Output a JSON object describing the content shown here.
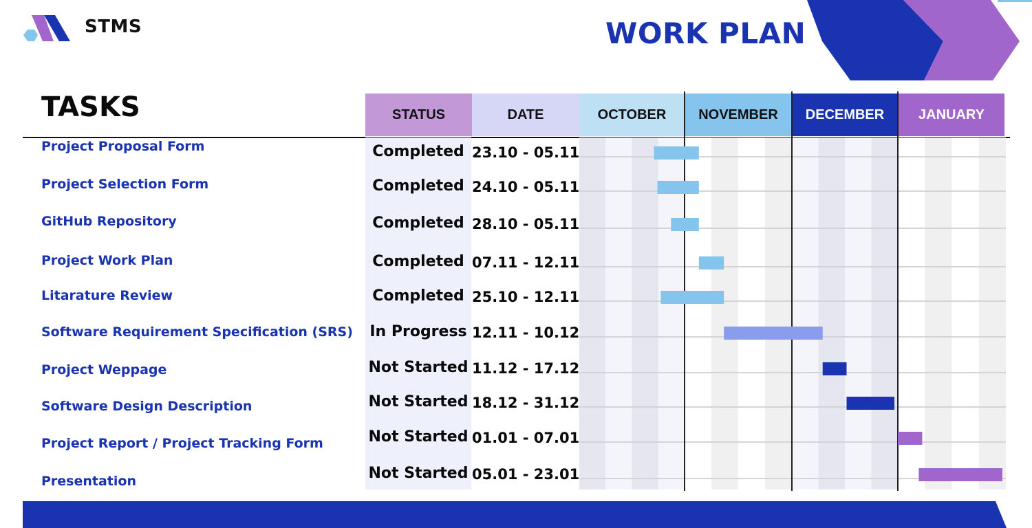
{
  "brand": {
    "name": "STMS"
  },
  "page_title": "WORK PLAN",
  "tasks_title": "TASKS",
  "colors": {
    "brand_blue": "#1a33b0",
    "purple": "#a066cc",
    "light_blue": "#85c4ec",
    "periwinkle": "#8a9cec"
  },
  "columns": [
    {
      "label": "STATUS",
      "bg": "#c298d6",
      "fg": "#111111"
    },
    {
      "label": "DATE",
      "bg": "#d6d6f7",
      "fg": "#111111"
    },
    {
      "label": "OCTOBER",
      "bg": "#bde0f4",
      "fg": "#111111"
    },
    {
      "label": "NOVEMBER",
      "bg": "#85c4ec",
      "fg": "#111111"
    },
    {
      "label": "DECEMBER",
      "bg": "#1a33b0",
      "fg": "#ffffff"
    },
    {
      "label": "JANUARY",
      "bg": "#a066cc",
      "fg": "#ffffff"
    }
  ],
  "chart_data": {
    "type": "gantt",
    "timeline_months": [
      "OCTOBER",
      "NOVEMBER",
      "DECEMBER",
      "JANUARY"
    ],
    "tasks": [
      {
        "name": "Project Proposal Form",
        "status": "Completed",
        "date": "23.10 - 05.11",
        "start": "10-23",
        "end": "11-05",
        "color": "#85c4ec"
      },
      {
        "name": "Project Selection Form",
        "status": "Completed",
        "date": "24.10 - 05.11",
        "start": "10-24",
        "end": "11-05",
        "color": "#85c4ec"
      },
      {
        "name": "GitHub Repository",
        "status": "Completed",
        "date": "28.10 - 05.11",
        "start": "10-28",
        "end": "11-05",
        "color": "#85c4ec"
      },
      {
        "name": "Project Work Plan",
        "status": "Completed",
        "date": "07.11 - 12.11",
        "start": "11-05",
        "end": "11-12",
        "color": "#85c4ec"
      },
      {
        "name": "Litarature Review",
        "status": "Completed",
        "date": "25.10 - 12.11",
        "start": "10-25",
        "end": "11-12",
        "color": "#85c4ec"
      },
      {
        "name": "Software Requirement Specification (SRS)",
        "status": "In Progress",
        "date": "12.11 - 10.12",
        "start": "11-12",
        "end": "12-10",
        "color": "#8a9cec"
      },
      {
        "name": "Project Weppage",
        "status": "Not Started",
        "date": "11.12 - 17.12",
        "start": "12-10",
        "end": "12-17",
        "color": "#1a33b0"
      },
      {
        "name": "Software Design Description",
        "status": "Not Started",
        "date": "18.12 - 31.12",
        "start": "12-17",
        "end": "12-31",
        "color": "#1a33b0"
      },
      {
        "name": "Project Report / Project Tracking Form",
        "status": "Not Started",
        "date": "01.01 - 07.01",
        "start": "01-01",
        "end": "01-08",
        "color": "#a066cc"
      },
      {
        "name": "Presentation",
        "status": "Not Started",
        "date": "05.01 - 23.01",
        "start": "01-07",
        "end": "01-31",
        "color": "#a066cc"
      }
    ]
  }
}
